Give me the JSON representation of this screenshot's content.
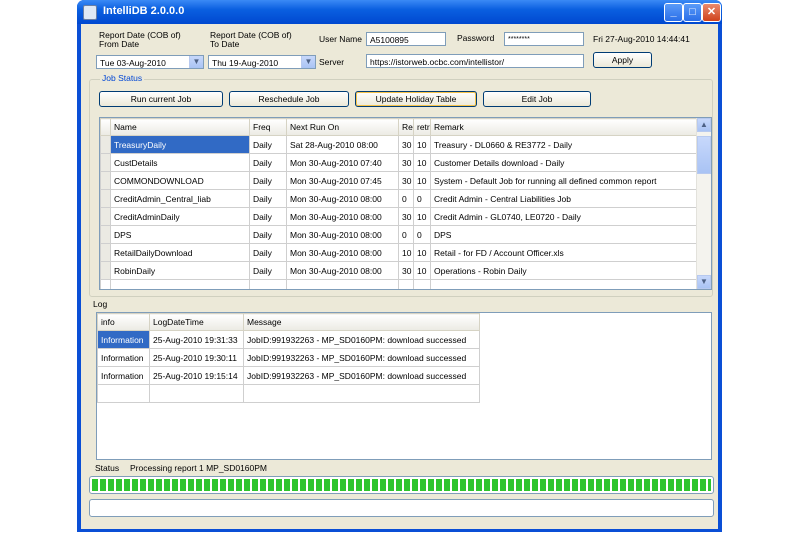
{
  "window": {
    "title": "IntelliDB 2.0.0.0",
    "minimize": "_",
    "maximize": "□",
    "close": "✕",
    "app_icon": "database-icon"
  },
  "header": {
    "from_label_1": "Report Date (COB of)",
    "from_label_2": "From Date",
    "to_label_1": "Report Date (COB of)",
    "to_label_2": "To Date",
    "from_date": "Tue 03-Aug-2010",
    "to_date": "Thu 19-Aug-2010",
    "user_name_label": "User Name",
    "user_name_value": "A5100895",
    "password_label": "Password",
    "password_value": "********",
    "clock": "Fri 27-Aug-2010 14:44:41",
    "server_label": "Server",
    "server_value": "https://istorweb.ocbc.com/intellistor/",
    "apply_label": "Apply"
  },
  "job_status": {
    "title": "Job Status",
    "buttons": [
      "Run current Job",
      "Reschedule Job",
      "Update Holiday Table",
      "Edit Job"
    ],
    "columns": [
      "Name",
      "Freq",
      "Next Run On",
      "Re",
      "retr",
      "Remark"
    ],
    "rows": [
      [
        "TreasuryDaily",
        "Daily",
        "Sat 28-Aug-2010 08:00",
        "30",
        "10",
        "Treasury - DL0660 & RE3772 - Daily"
      ],
      [
        "CustDetails",
        "Daily",
        "Mon 30-Aug-2010 07:40",
        "30",
        "10",
        "Customer Details download - Daily"
      ],
      [
        "COMMONDOWNLOAD",
        "Daily",
        "Mon 30-Aug-2010 07:45",
        "30",
        "10",
        "System - Default Job for running all defined common report"
      ],
      [
        "CreditAdmin_Central_liab",
        "Daily",
        "Mon 30-Aug-2010 08:00",
        "0",
        "0",
        "Credit Admin - Central Liabilities Job"
      ],
      [
        "CreditAdminDaily",
        "Daily",
        "Mon 30-Aug-2010 08:00",
        "30",
        "10",
        "Credit Admin - GL0740, LE0720 - Daily"
      ],
      [
        "DPS",
        "Daily",
        "Mon 30-Aug-2010 08:00",
        "0",
        "0",
        "DPS"
      ],
      [
        "RetailDailyDownload",
        "Daily",
        "Mon 30-Aug-2010 08:00",
        "10",
        "10",
        "Retail - for FD / Account Officer.xls"
      ],
      [
        "RobinDaily",
        "Daily",
        "Mon 30-Aug-2010 08:00",
        "30",
        "10",
        "Operations - Robin Daily"
      ]
    ]
  },
  "log": {
    "title": "Log",
    "columns": [
      "info",
      "LogDateTime",
      "Message"
    ],
    "rows": [
      [
        "Information",
        "25-Aug-2010 19:31:33",
        "JobID:991932263 - MP_SD0160PM: download successed"
      ],
      [
        "Information",
        "25-Aug-2010 19:30:11",
        "JobID:991932263 - MP_SD0160PM: download successed"
      ],
      [
        "Information",
        "25-Aug-2010 19:15:14",
        "JobID:991932263 - MP_SD0160PM: download successed"
      ]
    ]
  },
  "status": {
    "label": "Status",
    "text": "Processing report 1 MP_SD0160PM",
    "progress": 1.0
  },
  "colors": {
    "titlebar": "#0a5fe0",
    "selection": "#316ac5",
    "progress": "#2dc42d",
    "client": "#ece9d8"
  }
}
